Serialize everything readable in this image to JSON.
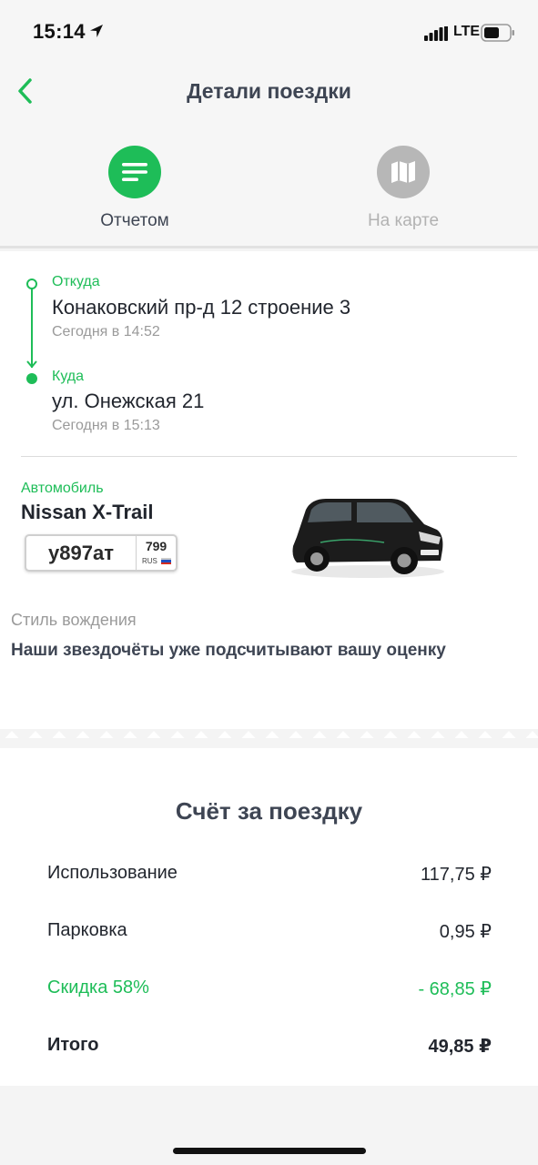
{
  "status_bar": {
    "time": "15:14",
    "network": "LTE",
    "icons": [
      "location-arrow-icon",
      "signal-icon",
      "battery-icon"
    ]
  },
  "nav": {
    "title": "Детали поездки",
    "back_icon": "chevron-left-icon"
  },
  "view_tabs": [
    {
      "label": "Отчетом",
      "icon": "list-icon",
      "active": true
    },
    {
      "label": "На карте",
      "icon": "map-icon",
      "active": false
    }
  ],
  "route": {
    "from": {
      "label": "Откуда",
      "address": "Конаковский пр-д 12 строение 3",
      "time": "Сегодня в 14:52"
    },
    "to": {
      "label": "Куда",
      "address": "ул. Онежская 21",
      "time": "Сегодня в 15:13"
    }
  },
  "car": {
    "label": "Автомобиль",
    "model": "Nissan X-Trail",
    "plate": {
      "number": "у897ат",
      "region": "799",
      "country": "RUS"
    }
  },
  "driving_style": {
    "label": "Стиль вождения",
    "text": "Наши звездочёты уже подсчитывают вашу оценку"
  },
  "bill": {
    "title": "Счёт за поездку",
    "rows": [
      {
        "name": "Использование",
        "value": "117,75 ₽"
      },
      {
        "name": "Парковка",
        "value": "0,95 ₽"
      },
      {
        "name": "Скидка 58%",
        "value": "- 68,85 ₽"
      },
      {
        "name": "Итого",
        "value": "49,85 ₽"
      }
    ]
  },
  "colors": {
    "accent": "#1ebd58",
    "inactive": "#b7b7b7",
    "title": "#3e4553",
    "secondary_text": "#9a9a9a"
  }
}
